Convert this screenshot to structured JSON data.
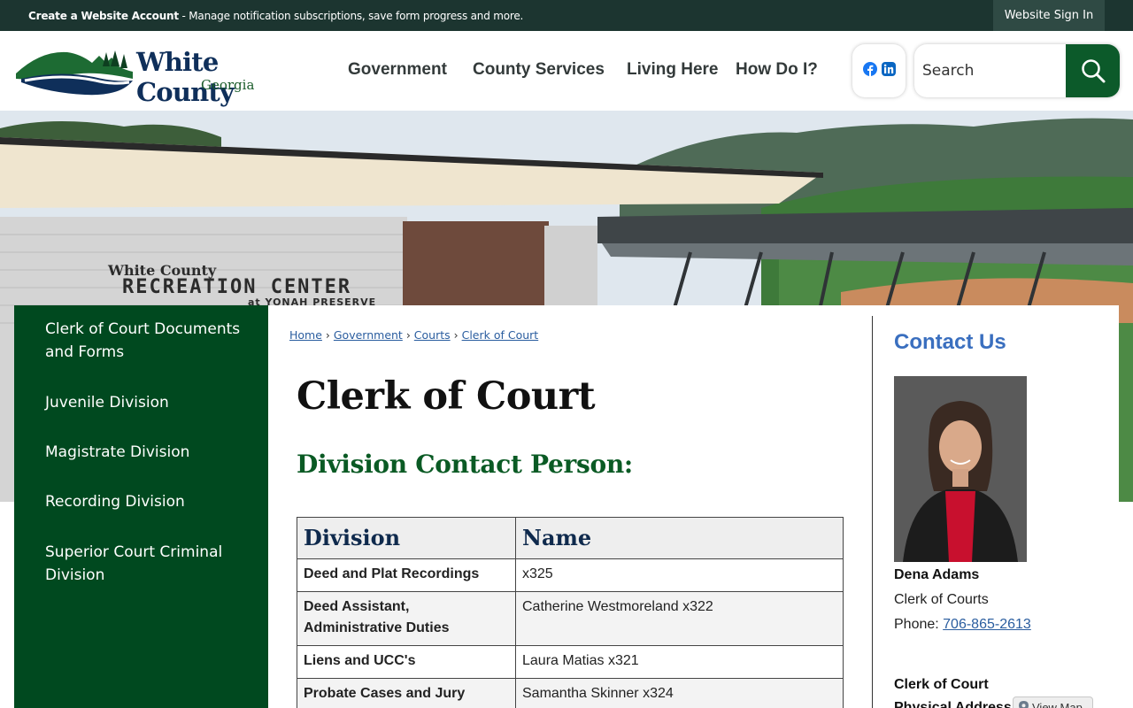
{
  "topbar": {
    "create_account": "Create a Website Account",
    "tagline": " - Manage notification subscriptions, save form progress and more.",
    "sign_in": "Website Sign In"
  },
  "brand": {
    "name": "White County",
    "state": "Georgia",
    "colors": {
      "primary_green": "#00491f",
      "dark_teal": "#1c3530",
      "navy": "#0f2f5a",
      "link_blue": "#2a5d9f"
    }
  },
  "nav": [
    "Government",
    "County Services",
    "Living Here",
    "How Do I?"
  ],
  "social": [
    "facebook-icon",
    "linkedin-icon"
  ],
  "search": {
    "placeholder": "Search"
  },
  "hero": {
    "sign_top": "White County",
    "sign_main": "RECREATION CENTER",
    "sign_sub": "at YONAH PRESERVE"
  },
  "sidebar": {
    "items": [
      "Clerk of Court Documents and Forms",
      "Juvenile Division",
      "Magistrate Division",
      "Recording Division",
      "Superior Court Criminal Division"
    ]
  },
  "breadcrumb": [
    "Home",
    "Government",
    "Courts",
    "Clerk of Court"
  ],
  "page": {
    "title": "Clerk of Court",
    "subheading": "Division Contact Person:"
  },
  "table": {
    "headers": [
      "Division",
      "Name"
    ],
    "rows": [
      [
        "Deed and Plat Recordings",
        "x325"
      ],
      [
        "Deed Assistant, Administrative Duties",
        "Catherine Westmoreland x322"
      ],
      [
        "Liens and UCC's",
        "Laura Matias x321"
      ],
      [
        "Probate Cases and Jury Information",
        "Samantha Skinner x324"
      ]
    ]
  },
  "contact": {
    "title": "Contact Us",
    "name": "Dena Adams",
    "role": "Clerk of Courts",
    "phone_label": "Phone: ",
    "phone": "706-865-2613",
    "address_title": "Clerk of Court Physical Address",
    "view_map": "View Map"
  }
}
